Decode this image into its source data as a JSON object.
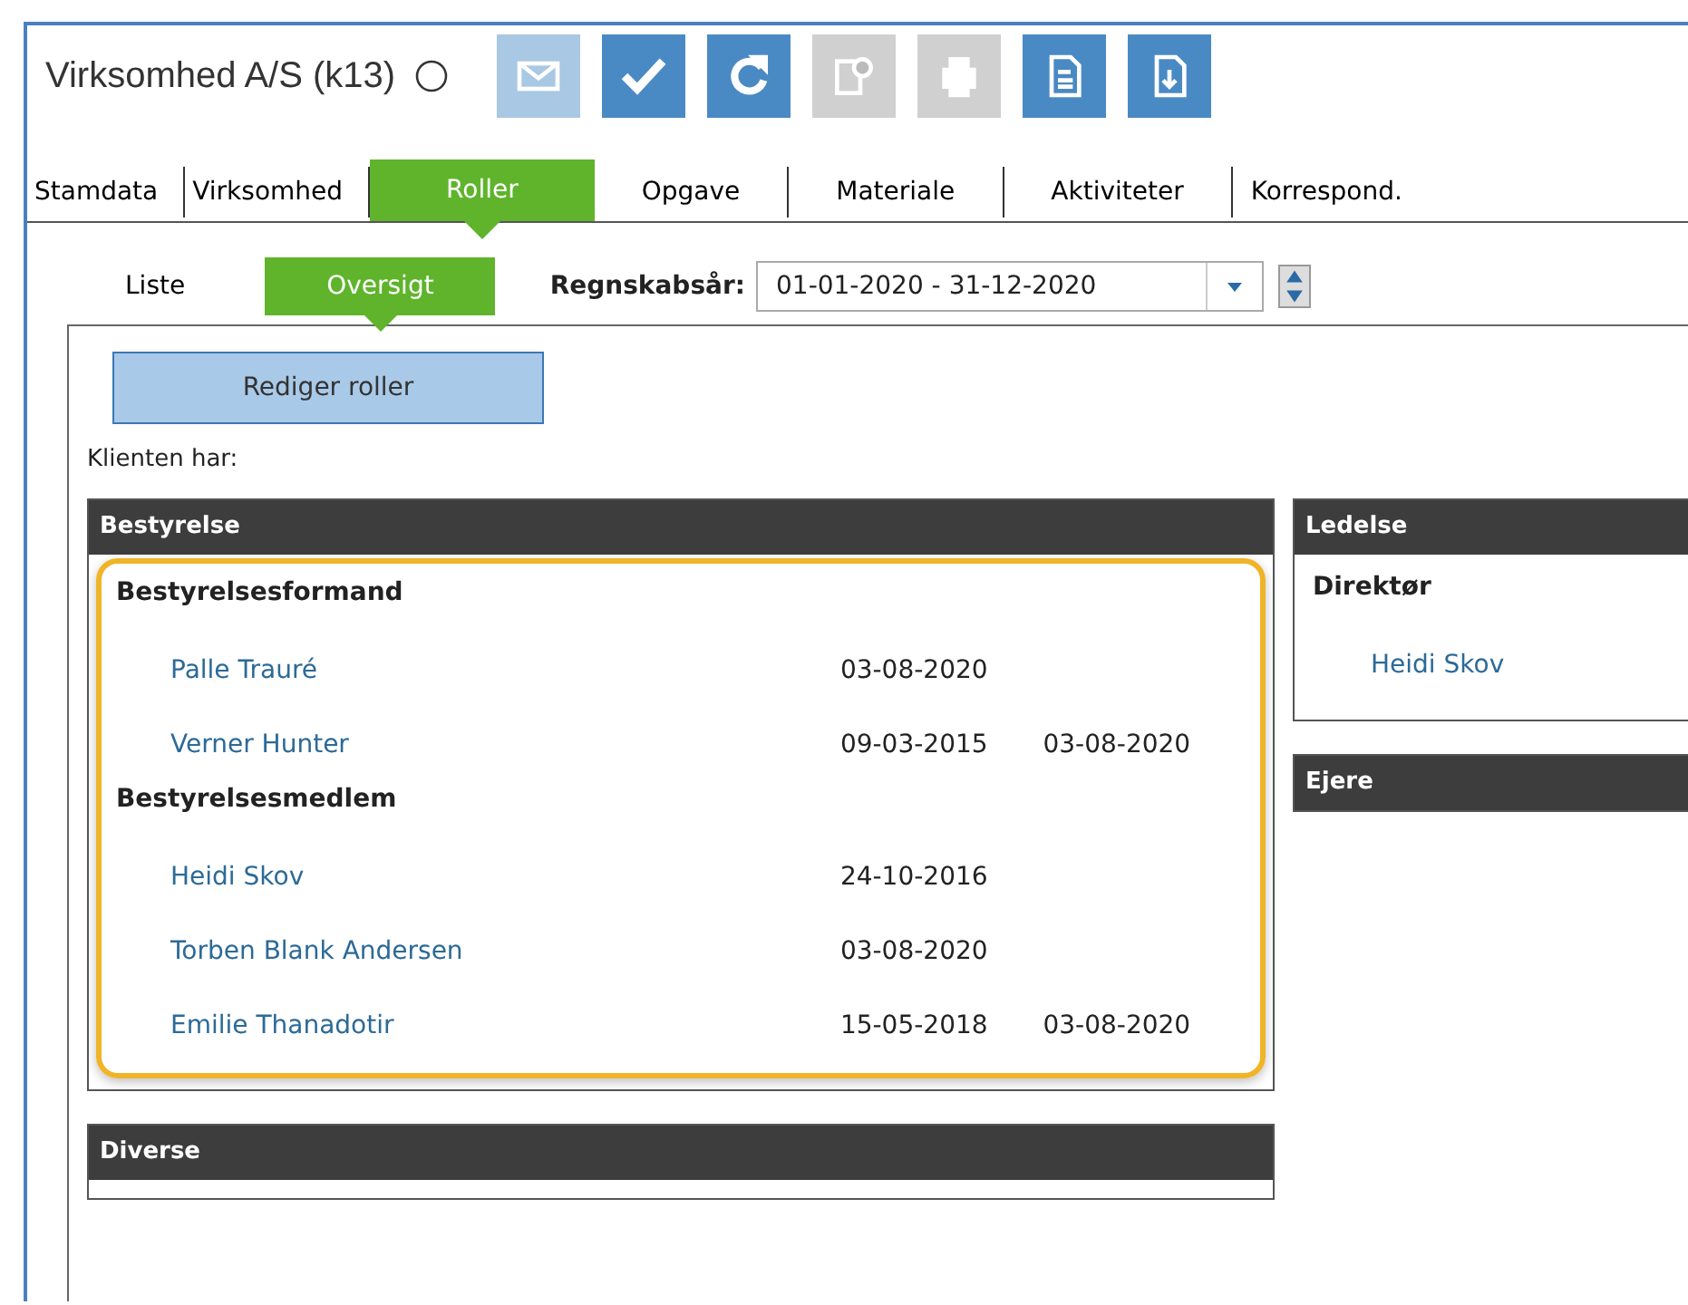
{
  "window": {
    "title": "Virksomhed A/S (k13)"
  },
  "toolbar": [
    {
      "disabled": true
    },
    {
      "disabled": false
    },
    {
      "disabled": false
    },
    {
      "disabled": true
    },
    {
      "disabled": true
    },
    {
      "disabled": false
    },
    {
      "disabled": false
    }
  ],
  "tabs": [
    {
      "label": "Stamdata",
      "selected": false
    },
    {
      "label": "Virksomhed",
      "selected": false
    },
    {
      "label": "Roller",
      "selected": true
    },
    {
      "label": "Opgave",
      "selected": false
    },
    {
      "label": "Materiale",
      "selected": false
    },
    {
      "label": "Aktiviteter",
      "selected": false
    },
    {
      "label": "Korrespond.",
      "selected": false
    }
  ],
  "subtabs": [
    {
      "label": "Liste",
      "selected": false
    },
    {
      "label": "Oversigt",
      "selected": true
    }
  ],
  "fiscal_year": {
    "label": "Regnskabsår:",
    "value": "01-01-2020 - 31-12-2020"
  },
  "edit_button": "Rediger roller",
  "intro": "Klienten har:",
  "board": {
    "title": "Bestyrelse",
    "highlighted": true,
    "groups": [
      {
        "title": "Bestyrelsesformand",
        "people": [
          {
            "name": "Palle Trauré",
            "start": "03-08-2020"
          },
          {
            "name": "Verner Hunter",
            "start": "09-03-2015",
            "end": "03-08-2020"
          }
        ]
      },
      {
        "title": "Bestyrelsesmedlem",
        "people": [
          {
            "name": "Heidi Skov",
            "start": "24-10-2016"
          },
          {
            "name": "Torben Blank Andersen",
            "start": "03-08-2020"
          },
          {
            "name": "Emilie Thanadotir",
            "start": "15-05-2018",
            "end": "03-08-2020"
          }
        ]
      }
    ]
  },
  "management": {
    "title": "Ledelse",
    "groups": [
      {
        "title": "Direktør",
        "people": [
          {
            "name": "Heidi Skov"
          }
        ]
      }
    ]
  },
  "owners": {
    "title": "Ejere"
  },
  "misc": {
    "title": "Diverse"
  }
}
